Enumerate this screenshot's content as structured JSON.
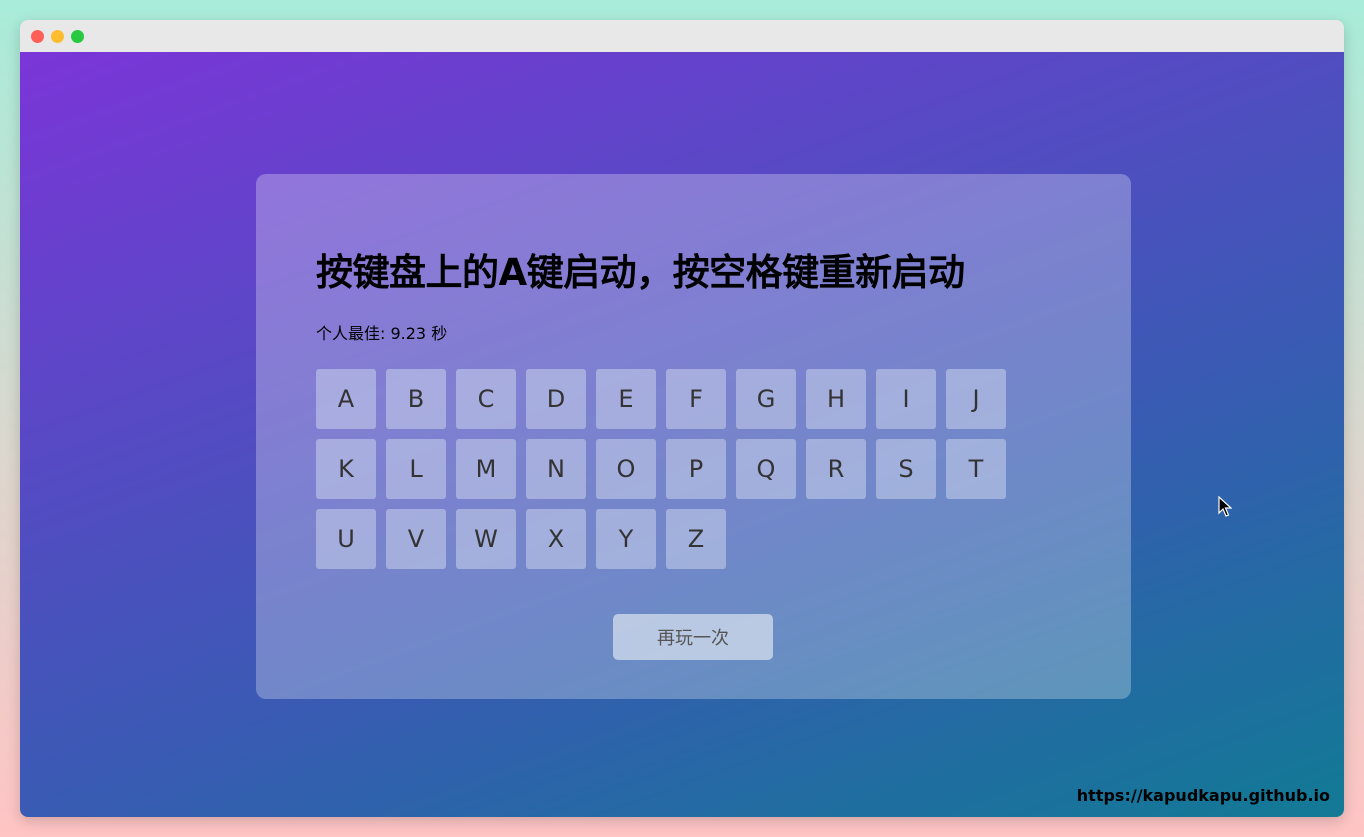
{
  "headline": "按键盘上的A键启动，按空格键重新启动",
  "best": "个人最佳: 9.23 秒",
  "keys": [
    "A",
    "B",
    "C",
    "D",
    "E",
    "F",
    "G",
    "H",
    "I",
    "J",
    "K",
    "L",
    "M",
    "N",
    "O",
    "P",
    "Q",
    "R",
    "S",
    "T",
    "U",
    "V",
    "W",
    "X",
    "Y",
    "Z"
  ],
  "replay_label": "再玩一次",
  "credit": "https://kapudkapu.github.io",
  "window_controls": [
    "close",
    "minimize",
    "maximize"
  ],
  "icons": {
    "cursor": "mouse-pointer-icon"
  }
}
